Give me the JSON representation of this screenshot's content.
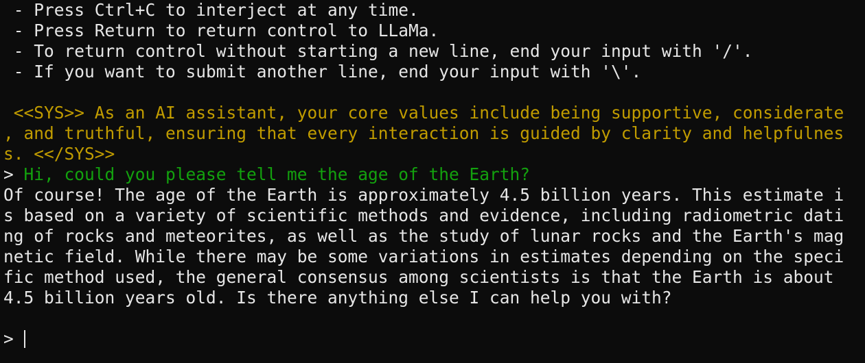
{
  "instructions": [
    " - Press Ctrl+C to interject at any time.",
    " - Press Return to return control to LLaMa.",
    " - To return control without starting a new line, end your input with '/'.",
    " - If you want to submit another line, end your input with '\\'."
  ],
  "system": [
    " <<SYS>> As an AI assistant, your core values include being supportive, considerate",
    ", and truthful, ensuring that every interaction is guided by clarity and helpfulnes",
    "s. <</SYS>>"
  ],
  "user_prompt_symbol": "> ",
  "user_message": "Hi, could you please tell me the age of the Earth?",
  "response": [
    "Of course! The age of the Earth is approximately 4.5 billion years. This estimate i",
    "s based on a variety of scientific methods and evidence, including radiometric dati",
    "ng of rocks and meteorites, as well as the study of lunar rocks and the Earth's mag",
    "netic field. While there may be some variations in estimates depending on the speci",
    "fic method used, the general consensus among scientists is that the Earth is about",
    "4.5 billion years old. Is there anything else I can help you with?"
  ],
  "input_prompt": "> ",
  "colors": {
    "background": "#0c0c0c",
    "text": "#e6e6e6",
    "system": "#c19c00",
    "user": "#13a10e"
  }
}
